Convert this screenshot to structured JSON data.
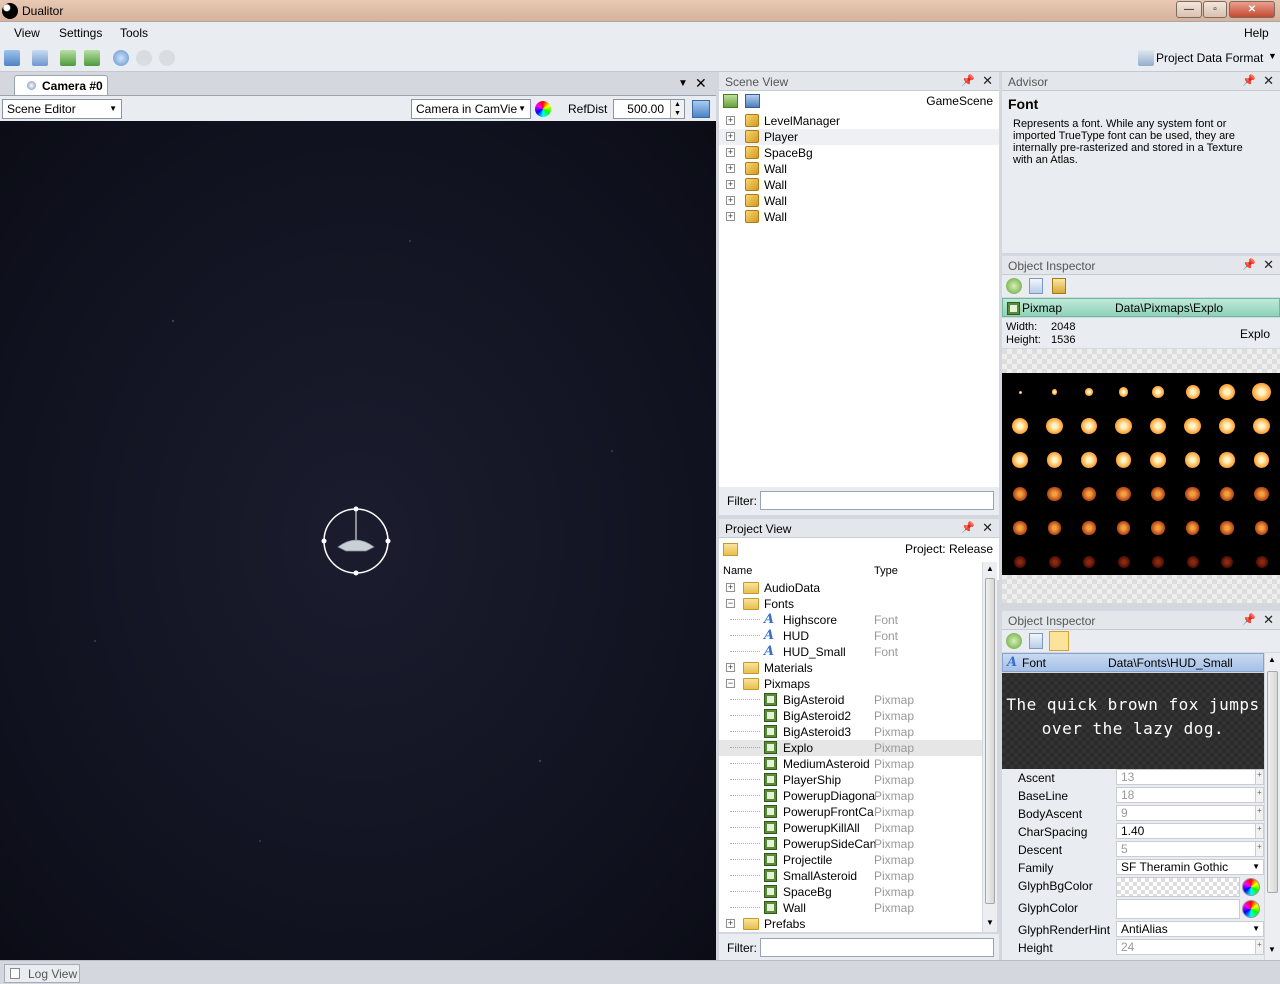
{
  "window": {
    "title": "Dualitor",
    "minimize": "—",
    "maximize": "▫",
    "close": "✕"
  },
  "menu": {
    "view": "View",
    "settings": "Settings",
    "tools": "Tools",
    "help": "Help"
  },
  "toolbar": {
    "data_format": "Project Data Format"
  },
  "camera_panel": {
    "tab": "Camera #0",
    "mode": "Scene Editor",
    "camera_select": "Camera in CamVie",
    "refdist_label": "RefDist",
    "refdist_value": "500.00"
  },
  "scene_view": {
    "title": "Scene View",
    "scene_name": "GameScene",
    "items": [
      "LevelManager",
      "Player",
      "SpaceBg",
      "Wall",
      "Wall",
      "Wall",
      "Wall"
    ],
    "filter_label": "Filter:"
  },
  "project_view": {
    "title": "Project View",
    "project_label": "Project: Release",
    "col_name": "Name",
    "col_type": "Type",
    "filter_label": "Filter:",
    "rows": [
      {
        "name": "AudioData",
        "type": "",
        "kind": "folder",
        "level": 0,
        "exp": "+"
      },
      {
        "name": "Fonts",
        "type": "",
        "kind": "folder",
        "level": 0,
        "exp": "−"
      },
      {
        "name": "Highscore",
        "type": "Font",
        "kind": "font",
        "level": 1,
        "exp": ""
      },
      {
        "name": "HUD",
        "type": "Font",
        "kind": "font",
        "level": 1,
        "exp": ""
      },
      {
        "name": "HUD_Small",
        "type": "Font",
        "kind": "font",
        "level": 1,
        "exp": ""
      },
      {
        "name": "Materials",
        "type": "",
        "kind": "folder",
        "level": 0,
        "exp": "+"
      },
      {
        "name": "Pixmaps",
        "type": "",
        "kind": "folder",
        "level": 0,
        "exp": "−"
      },
      {
        "name": "BigAsteroid",
        "type": "Pixmap",
        "kind": "pix",
        "level": 1,
        "exp": ""
      },
      {
        "name": "BigAsteroid2",
        "type": "Pixmap",
        "kind": "pix",
        "level": 1,
        "exp": ""
      },
      {
        "name": "BigAsteroid3",
        "type": "Pixmap",
        "kind": "pix",
        "level": 1,
        "exp": ""
      },
      {
        "name": "Explo",
        "type": "Pixmap",
        "kind": "pix",
        "level": 1,
        "exp": ""
      },
      {
        "name": "MediumAsteroid",
        "type": "Pixmap",
        "kind": "pix",
        "level": 1,
        "exp": ""
      },
      {
        "name": "PlayerShip",
        "type": "Pixmap",
        "kind": "pix",
        "level": 1,
        "exp": ""
      },
      {
        "name": "PowerupDiagona",
        "type": "Pixmap",
        "kind": "pix",
        "level": 1,
        "exp": ""
      },
      {
        "name": "PowerupFrontCa",
        "type": "Pixmap",
        "kind": "pix",
        "level": 1,
        "exp": ""
      },
      {
        "name": "PowerupKillAll",
        "type": "Pixmap",
        "kind": "pix",
        "level": 1,
        "exp": ""
      },
      {
        "name": "PowerupSideCan",
        "type": "Pixmap",
        "kind": "pix",
        "level": 1,
        "exp": ""
      },
      {
        "name": "Projectile",
        "type": "Pixmap",
        "kind": "pix",
        "level": 1,
        "exp": ""
      },
      {
        "name": "SmallAsteroid",
        "type": "Pixmap",
        "kind": "pix",
        "level": 1,
        "exp": ""
      },
      {
        "name": "SpaceBg",
        "type": "Pixmap",
        "kind": "pix",
        "level": 1,
        "exp": ""
      },
      {
        "name": "Wall",
        "type": "Pixmap",
        "kind": "pix",
        "level": 1,
        "exp": ""
      },
      {
        "name": "Prefabs",
        "type": "",
        "kind": "folder",
        "level": 0,
        "exp": "+"
      }
    ]
  },
  "advisor": {
    "title": "Advisor",
    "heading": "Font",
    "text": "Represents a font. While any system font or imported TrueType font can be used, they are internally pre-rasterized and stored in a Texture with an Atlas."
  },
  "inspector1": {
    "title": "Object Inspector",
    "type": "Pixmap",
    "path": "Data\\Pixmaps\\Explo",
    "width_label": "Width:",
    "width": "2048",
    "height_label": "Height:",
    "height": "1536",
    "name": "Explo"
  },
  "inspector2": {
    "title": "Object Inspector",
    "type": "Font",
    "path": "Data\\Fonts\\HUD_Small",
    "preview_line1": "The quick brown fox jumps",
    "preview_line2": "over the lazy dog.",
    "props": [
      {
        "label": "Ascent",
        "value": "13"
      },
      {
        "label": "BaseLine",
        "value": "18"
      },
      {
        "label": "BodyAscent",
        "value": "9"
      },
      {
        "label": "CharSpacing",
        "value": "1.40"
      },
      {
        "label": "Descent",
        "value": "5"
      },
      {
        "label": "Family",
        "value": "SF Theramin Gothic"
      },
      {
        "label": "GlyphBgColor",
        "value": ""
      },
      {
        "label": "GlyphColor",
        "value": ""
      },
      {
        "label": "GlyphRenderHint",
        "value": "AntiAlias"
      },
      {
        "label": "Height",
        "value": "24"
      }
    ]
  },
  "statusbar": {
    "log_view": "Log View"
  }
}
